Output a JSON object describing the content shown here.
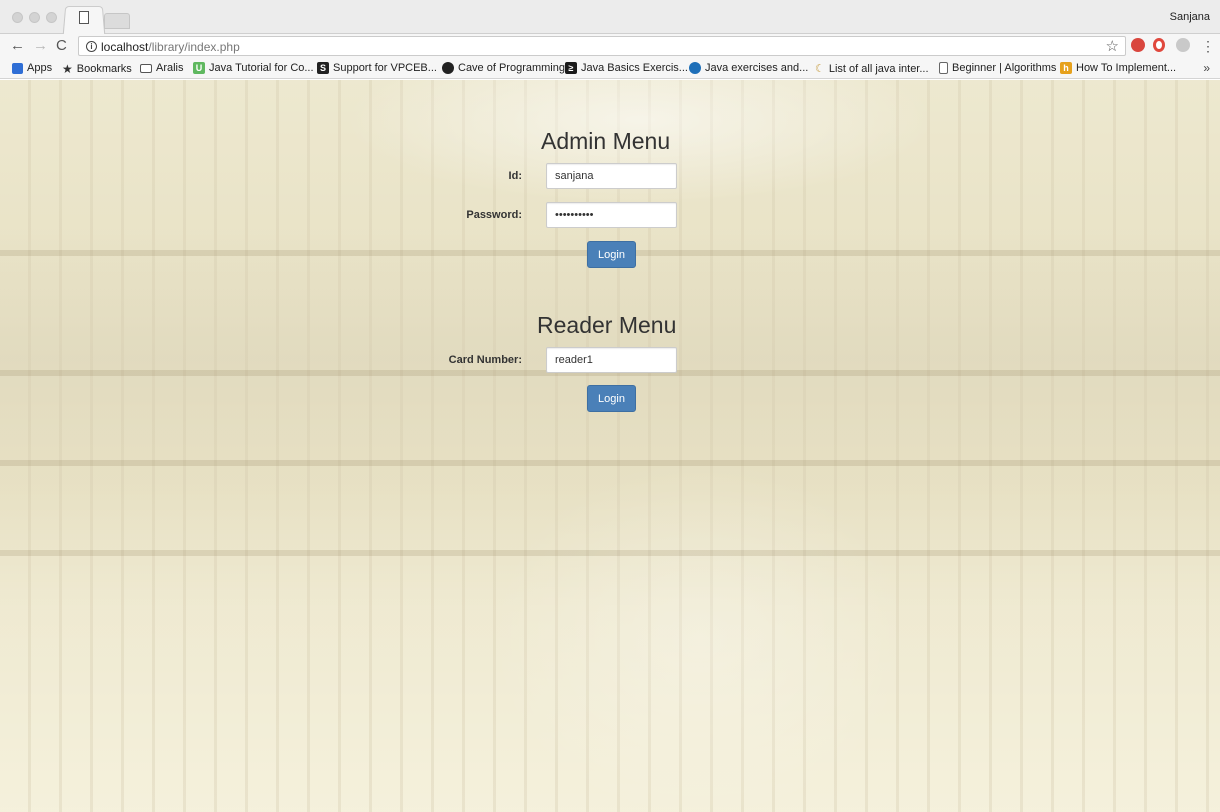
{
  "browser": {
    "profile_name": "Sanjana",
    "url_host": "localhost",
    "url_path": "/library/index.php",
    "bookmarks": [
      {
        "label": "Apps",
        "icon": "apps-grid-icon"
      },
      {
        "label": "Bookmarks",
        "icon": "star-icon"
      },
      {
        "label": "Aralis",
        "icon": "folder-icon"
      },
      {
        "label": "Java Tutorial for Co...",
        "icon": "udemy-icon"
      },
      {
        "label": "Support for VPCEB...",
        "icon": "s-icon"
      },
      {
        "label": "Cave of Programming",
        "icon": "yin-yang-icon"
      },
      {
        "label": "Java Basics Exercis...",
        "icon": "exercise-icon"
      },
      {
        "label": "Java exercises and...",
        "icon": "compass-icon"
      },
      {
        "label": "List of all java inter...",
        "icon": "moon-icon"
      },
      {
        "label": "Beginner | Algorithms",
        "icon": "page-icon"
      },
      {
        "label": "How To Implement...",
        "icon": "bookmark-icon"
      }
    ],
    "more_label": "»"
  },
  "admin": {
    "heading": "Admin Menu",
    "id_label": "Id:",
    "id_value": "sanjana",
    "password_label": "Password:",
    "password_value": "••••••••••",
    "login_label": "Login"
  },
  "reader": {
    "heading": "Reader Menu",
    "card_label": "Card Number:",
    "card_value": "reader1",
    "login_label": "Login"
  }
}
